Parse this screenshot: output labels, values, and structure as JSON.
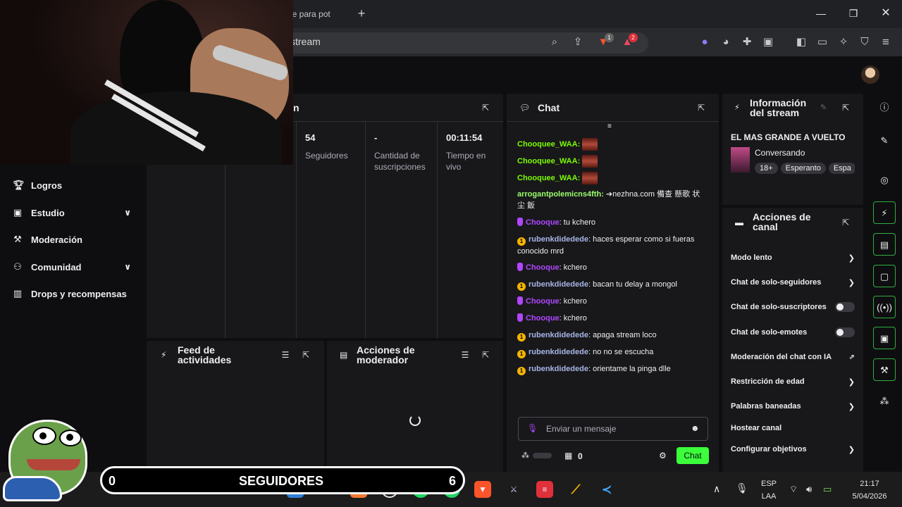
{
  "browser": {
    "active_tab_label": "are para pot",
    "new_tab_icon": "plus-icon",
    "url_text": "stream",
    "brave_badge": "1",
    "rewards_badge": "2"
  },
  "nav": {
    "items": [
      {
        "label": "Logros",
        "icon": "trophy-icon"
      },
      {
        "label": "Estudio",
        "icon": "studio-icon",
        "expandable": true
      },
      {
        "label": "Moderación",
        "icon": "wrench-icon"
      },
      {
        "label": "Comunidad",
        "icon": "community-icon",
        "expandable": true
      },
      {
        "label": "Drops y recompensas",
        "icon": "drops-icon"
      }
    ]
  },
  "session": {
    "title_fragment": "n",
    "stats": [
      {
        "value": "54",
        "label": "Seguidores"
      },
      {
        "value": "-",
        "label": "Cantidad de suscripciones"
      },
      {
        "value": "00:11:54",
        "label": "Tiempo en vivo"
      }
    ]
  },
  "activity_feed": {
    "title_l1": "Feed de",
    "title_l2": "actividades"
  },
  "mod_actions": {
    "title_l1": "Acciones de",
    "title_l2": "moderador"
  },
  "chat": {
    "title": "Chat",
    "messages": [
      {
        "user": "Chooquee_WAA",
        "style": "green",
        "text": ""
      },
      {
        "user": "Chooquee_WAA",
        "style": "green",
        "text": ""
      },
      {
        "user": "Chooquee_WAA",
        "style": "green",
        "text": ""
      },
      {
        "user": "arrogantpolemicns4fth",
        "style": "lime",
        "text": "➔nezhna.com 備查 懸歌 状 尘 鈑"
      },
      {
        "user": "Chooque",
        "style": "purple",
        "badge": "mod",
        "text": "tu kchero"
      },
      {
        "user": "rubenkdidedede",
        "style": "blue",
        "badge": "gold",
        "text": "haces esperar como si fueras conocido mrd"
      },
      {
        "user": "Chooque",
        "style": "purple",
        "badge": "mod",
        "text": "kchero"
      },
      {
        "user": "rubenkdidedede",
        "style": "blue",
        "badge": "gold",
        "text": "bacan tu delay a mongol"
      },
      {
        "user": "Chooque",
        "style": "purple",
        "badge": "mod",
        "text": "kchero"
      },
      {
        "user": "Chooque",
        "style": "purple",
        "badge": "mod",
        "text": "kchero"
      },
      {
        "user": "rubenkdidedede",
        "style": "blue",
        "badge": "gold",
        "text": "apaga stream loco"
      },
      {
        "user": "rubenkdidedede",
        "style": "blue",
        "badge": "gold",
        "text": "no no se escucha"
      },
      {
        "user": "rubenkdidedede",
        "style": "blue",
        "badge": "gold",
        "text": "orientame la pinga dlle"
      }
    ],
    "input_placeholder": "Enviar un mensaje",
    "points": "0",
    "send_label": "Chat"
  },
  "stream_info": {
    "title_l1": "Información",
    "title_l2": "del stream",
    "stream_title": "EL MAS GRANDE A VUELTO",
    "category": "Conversando",
    "tags": [
      "18+",
      "Esperanto",
      "Espa"
    ]
  },
  "channel_actions": {
    "title_l1": "Acciones de",
    "title_l2": "canal",
    "items": [
      {
        "label": "Modo lento",
        "control": "chevron"
      },
      {
        "label": "Chat de solo-seguidores",
        "control": "chevron"
      },
      {
        "label": "Chat de solo-suscriptores",
        "control": "toggle"
      },
      {
        "label": "Chat de solo-emotes",
        "control": "toggle"
      },
      {
        "label": "Moderación del chat con IA",
        "control": "external"
      },
      {
        "label": "Restricción de edad",
        "control": "chevron"
      },
      {
        "label": "Palabras baneadas",
        "control": "chevron"
      },
      {
        "label": "Hostear canal",
        "control": "none"
      },
      {
        "label": "Configurar objetivos",
        "control": "chevron"
      }
    ]
  },
  "overlay": {
    "left_count": "0",
    "label": "SEGUIDORES",
    "right_count": "6"
  },
  "taskbar": {
    "lang_top": "ESP",
    "lang_bottom": "LAA",
    "time": "21:17",
    "date": "5/04/2026"
  },
  "colors": {
    "accent_green": "#3cff3c",
    "mod_purple": "#b146ff",
    "panel": "#18181b"
  }
}
